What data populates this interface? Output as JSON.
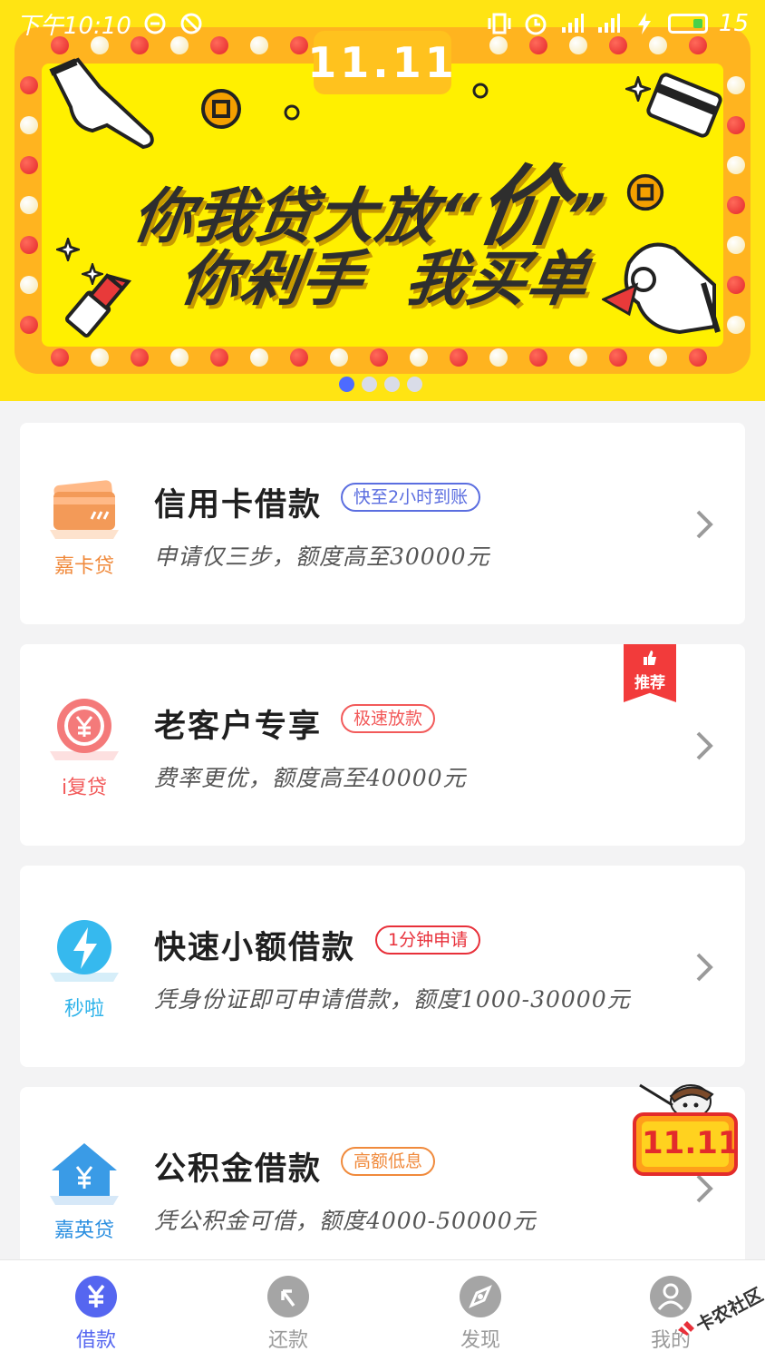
{
  "status_bar": {
    "time": "下午10:10",
    "battery_level": "15"
  },
  "banner": {
    "badge": "11.11",
    "slogan_line1_part1": "你我贷大放",
    "slogan_line1_quote_open": "“",
    "slogan_line1_big": "价",
    "slogan_line1_quote_close": "”",
    "slogan_line2": "你剁手  我买单",
    "pager_count": 4,
    "pager_active": 0
  },
  "colors": {
    "accent": "#5566f0",
    "banner_bg": "#ffe413",
    "red": "#f23b3b"
  },
  "cards": [
    {
      "logo_icon": "credit-card-icon",
      "logo_label": "嘉卡贷",
      "logo_color": "#f08a3c",
      "title": "信用卡借款",
      "tag": "快至2小时到账",
      "tag_color": "#5b6ee0",
      "desc": "申请仅三步，额度高至30000元"
    },
    {
      "logo_icon": "yen-refresh-icon",
      "logo_label": "i复贷",
      "logo_color": "#f25a5a",
      "title": "老客户专享",
      "tag": "极速放款",
      "tag_color": "#f25a5a",
      "desc": "费率更优，额度高至40000元",
      "ribbon": "推荐"
    },
    {
      "logo_icon": "lightning-icon",
      "logo_label": "秒啦",
      "logo_color": "#2eb3ea",
      "title": "快速小额借款",
      "tag": "1分钟申请",
      "tag_color": "#e8303a",
      "desc": "凭身份证即可申请借款，额度1000-30000元"
    },
    {
      "logo_icon": "yen-house-icon",
      "logo_label": "嘉英贷",
      "logo_color": "#2b8fe0",
      "title": "公积金借款",
      "tag": "高额低息",
      "tag_color": "#f08a3c",
      "desc": "凭公积金可借，额度4000-50000元"
    }
  ],
  "float_badge": "11.11",
  "tabbar": [
    {
      "label": "借款",
      "icon": "yen-icon",
      "active": true
    },
    {
      "label": "还款",
      "icon": "return-arrow-icon",
      "active": false
    },
    {
      "label": "发现",
      "icon": "compass-icon",
      "active": false
    },
    {
      "label": "我的",
      "icon": "user-icon",
      "active": false
    }
  ],
  "watermark": "卡农社区"
}
